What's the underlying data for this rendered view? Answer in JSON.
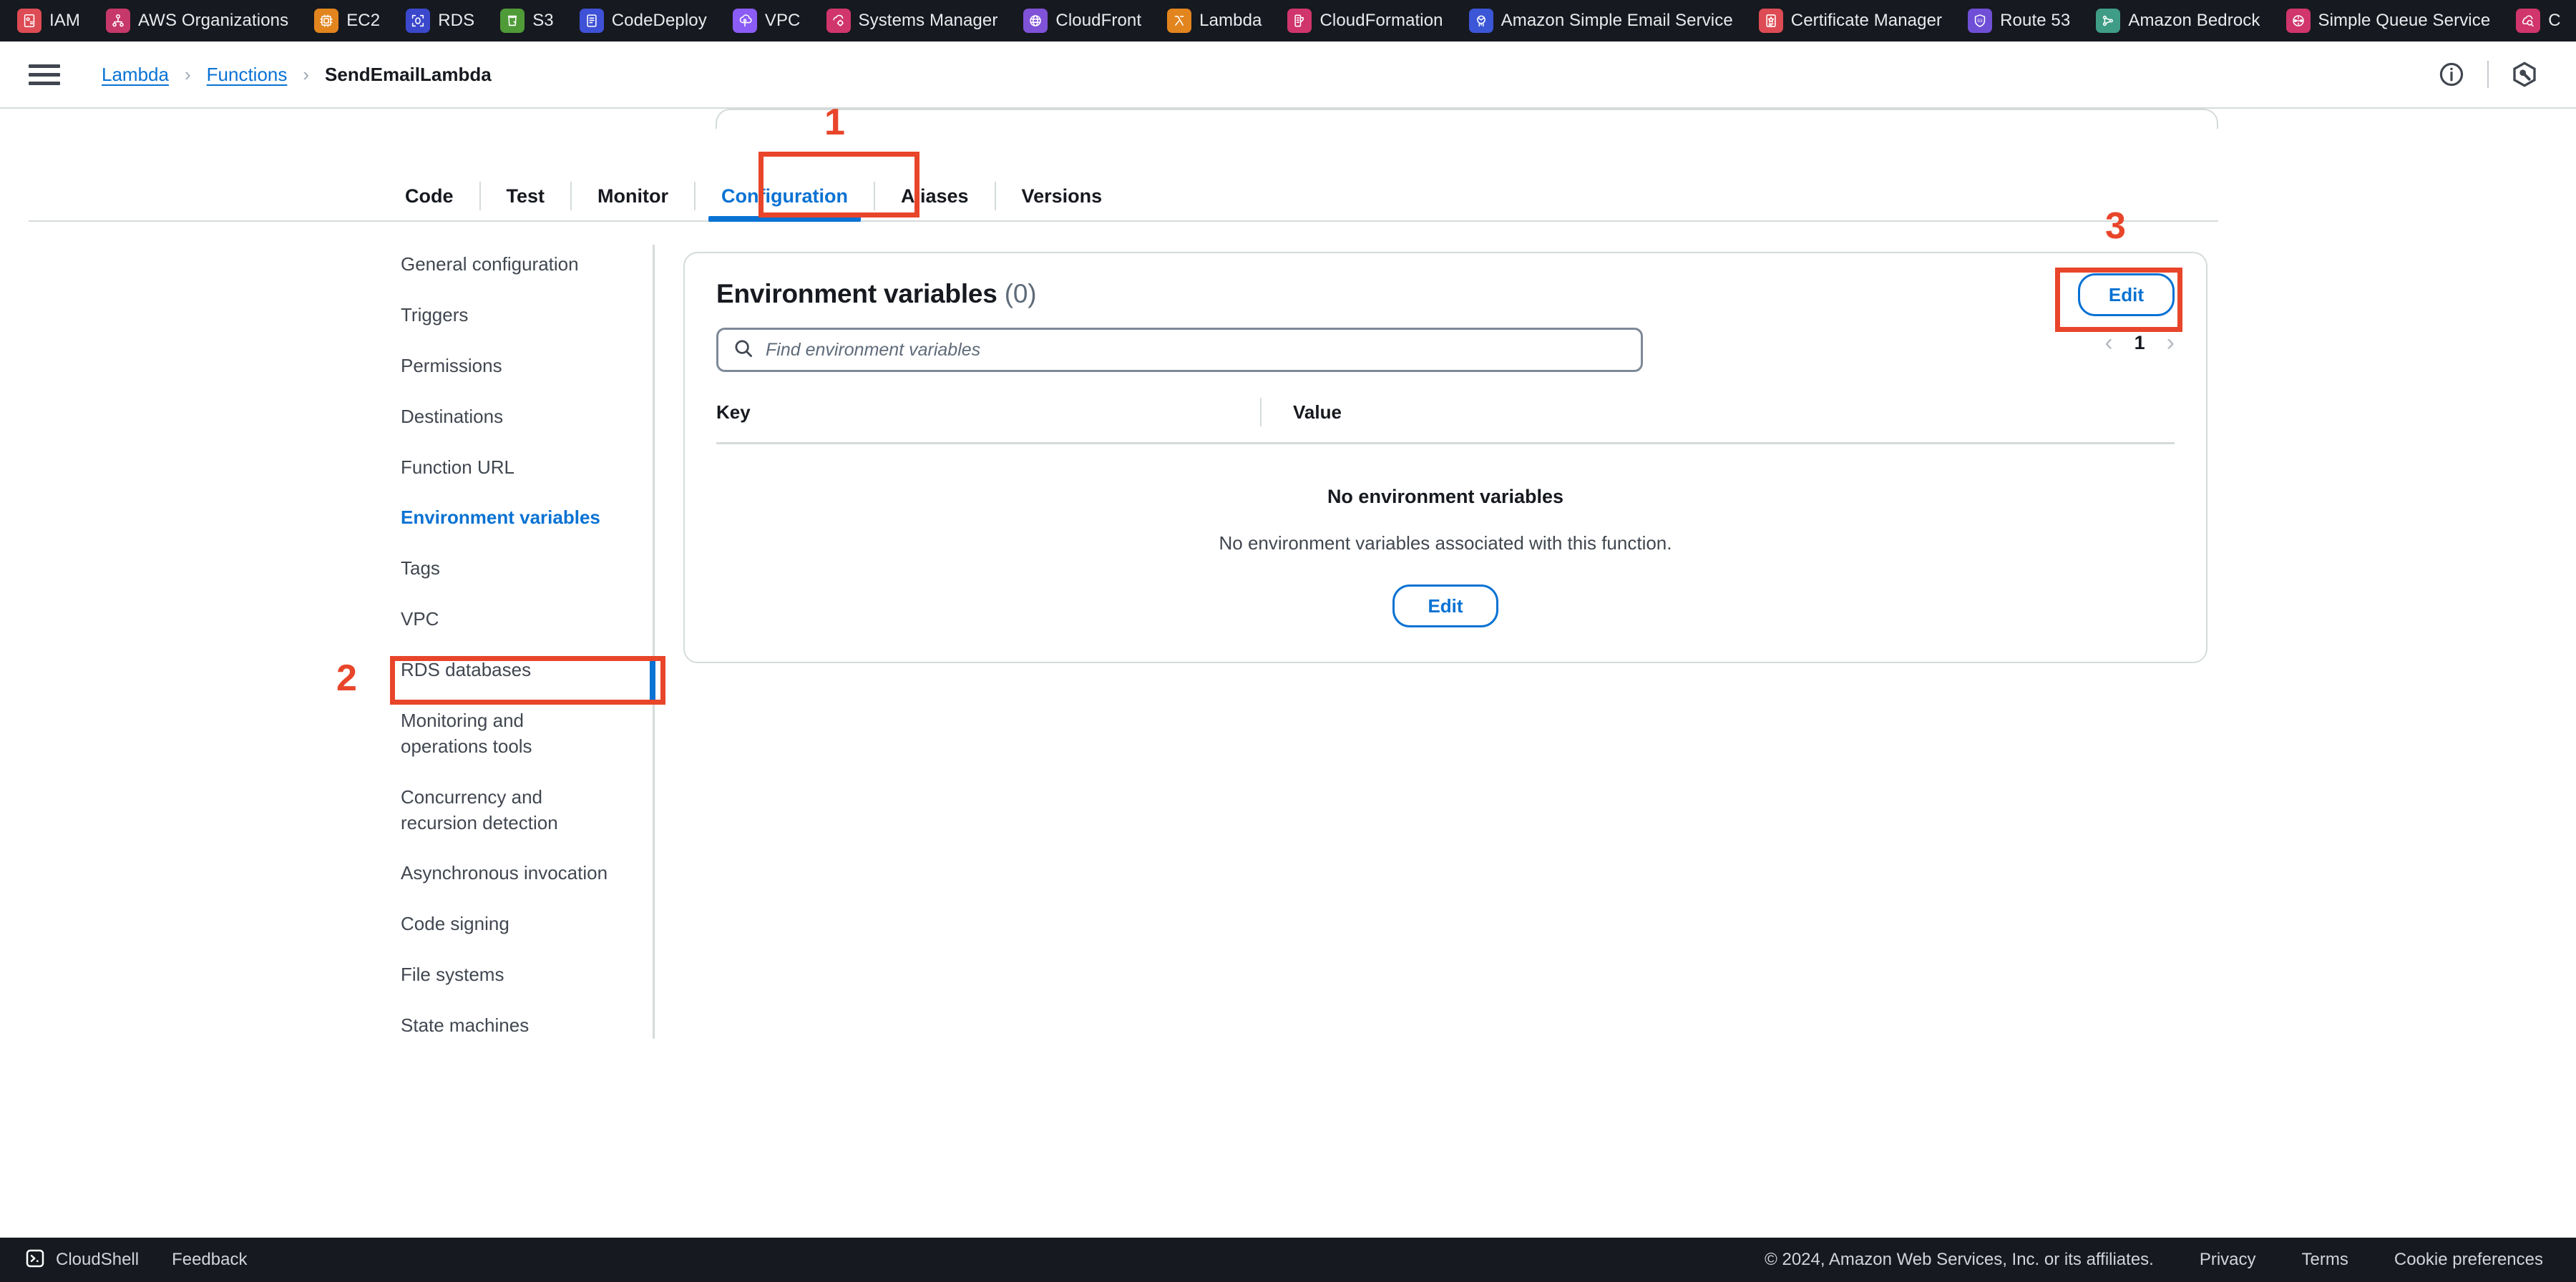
{
  "bookmarks": [
    {
      "label": "IAM",
      "icon": "iam-icon",
      "color": "#dd4b54"
    },
    {
      "label": "AWS Organizations",
      "icon": "organizations-icon",
      "color": "#c7386a"
    },
    {
      "label": "EC2",
      "icon": "ec2-icon",
      "color": "#e2851f"
    },
    {
      "label": "RDS",
      "icon": "rds-icon",
      "color": "#3b48cc"
    },
    {
      "label": "S3",
      "icon": "s3-icon",
      "color": "#4f9b38"
    },
    {
      "label": "CodeDeploy",
      "icon": "codedeploy-icon",
      "color": "#3f51d6"
    },
    {
      "label": "VPC",
      "icon": "vpc-icon",
      "color": "#8b5cf6"
    },
    {
      "label": "Systems Manager",
      "icon": "systems-manager-icon",
      "color": "#d0356c"
    },
    {
      "label": "CloudFront",
      "icon": "cloudfront-icon",
      "color": "#8052d8"
    },
    {
      "label": "Lambda",
      "icon": "lambda-icon",
      "color": "#e2851f"
    },
    {
      "label": "CloudFormation",
      "icon": "cloudformation-icon",
      "color": "#d0356c"
    },
    {
      "label": "Amazon Simple Email Service",
      "icon": "ses-icon",
      "color": "#3b56d6"
    },
    {
      "label": "Certificate Manager",
      "icon": "certificate-manager-icon",
      "color": "#dd4b54"
    },
    {
      "label": "Route 53",
      "icon": "route53-icon",
      "color": "#6f4fd6"
    },
    {
      "label": "Amazon Bedrock",
      "icon": "bedrock-icon",
      "color": "#3f9d87"
    },
    {
      "label": "Simple Queue Service",
      "icon": "sqs-icon",
      "color": "#d0356c"
    },
    {
      "label": "C",
      "icon": "cloudwatch-icon",
      "color": "#d0356c"
    }
  ],
  "bookmarks_overflow": "›",
  "header": {
    "menu_icon": "hamburger-icon",
    "breadcrumb": {
      "root": "Lambda",
      "section": "Functions",
      "current": "SendEmailLambda",
      "separator": "›"
    },
    "info_icon": "info-icon",
    "settings_icon": "settings-hex-icon"
  },
  "tabs": [
    {
      "label": "Code",
      "active": false
    },
    {
      "label": "Test",
      "active": false
    },
    {
      "label": "Monitor",
      "active": false
    },
    {
      "label": "Configuration",
      "active": true
    },
    {
      "label": "Aliases",
      "active": false
    },
    {
      "label": "Versions",
      "active": false
    }
  ],
  "sidenav": [
    {
      "label": "General configuration",
      "active": false
    },
    {
      "label": "Triggers",
      "active": false
    },
    {
      "label": "Permissions",
      "active": false
    },
    {
      "label": "Destinations",
      "active": false
    },
    {
      "label": "Function URL",
      "active": false
    },
    {
      "label": "Environment variables",
      "active": true
    },
    {
      "label": "Tags",
      "active": false
    },
    {
      "label": "VPC",
      "active": false
    },
    {
      "label": "RDS databases",
      "active": false
    },
    {
      "label": "Monitoring and\noperations tools",
      "active": false
    },
    {
      "label": "Concurrency and\nrecursion detection",
      "active": false
    },
    {
      "label": "Asynchronous invocation",
      "active": false
    },
    {
      "label": "Code signing",
      "active": false
    },
    {
      "label": "File systems",
      "active": false
    },
    {
      "label": "State machines",
      "active": false
    }
  ],
  "panel": {
    "title": "Environment variables",
    "count": "(0)",
    "edit_label": "Edit",
    "search_placeholder": "Find environment variables",
    "search_value": "",
    "search_icon": "search-icon",
    "pagination": {
      "prev_icon": "chevron-left-icon",
      "page": "1",
      "next_icon": "chevron-right-icon"
    },
    "columns": [
      "Key",
      "Value"
    ],
    "empty_title": "No environment variables",
    "empty_subtitle": "No environment variables associated with this function.",
    "empty_edit_label": "Edit"
  },
  "annotations": [
    {
      "number": "1",
      "target": "configuration-tab"
    },
    {
      "number": "2",
      "target": "environment-variables-nav-item"
    },
    {
      "number": "3",
      "target": "edit-button"
    }
  ],
  "annotation_color": "#e8452a",
  "accent_color": "#0972d3",
  "footer": {
    "cloudshell_icon": "cloudshell-icon",
    "cloudshell": "CloudShell",
    "feedback": "Feedback",
    "copyright": "© 2024, Amazon Web Services, Inc. or its affiliates.",
    "links": [
      "Privacy",
      "Terms",
      "Cookie preferences"
    ]
  }
}
